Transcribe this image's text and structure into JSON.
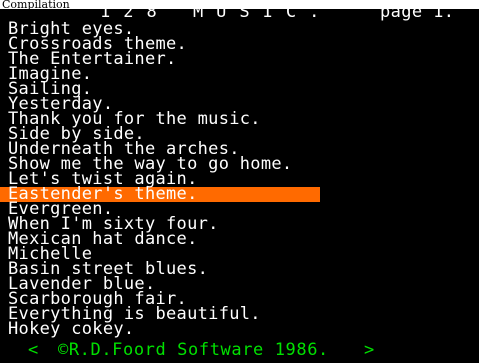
{
  "caption": "Compilation",
  "header": {
    "title": "128 MUSIC.",
    "page": "page 1."
  },
  "songs": [
    "Bright eyes.",
    "Crossroads theme.",
    "The Entertainer.",
    "Imagine.",
    "Sailing.",
    "Yesterday.",
    "Thank you for the music.",
    "Side by side.",
    "Underneath the arches.",
    "Show me the way to go home.",
    "Let's twist again.",
    "Eastender's theme.",
    "Evergreen.",
    "When I'm sixty four.",
    "Mexican hat dance.",
    "Michelle",
    "Basin street blues.",
    "Lavender blue.",
    "Scarborough fair.",
    "Everything is beautiful.",
    "Hokey cokey."
  ],
  "selected_index": 11,
  "footer": {
    "prev": "<",
    "copyright": "©R.D.Foord Software 1986.",
    "next": ">"
  },
  "colors": {
    "background": "#000000",
    "text": "#ffffff",
    "highlight": "#ff6a00",
    "footer": "#00e000"
  }
}
